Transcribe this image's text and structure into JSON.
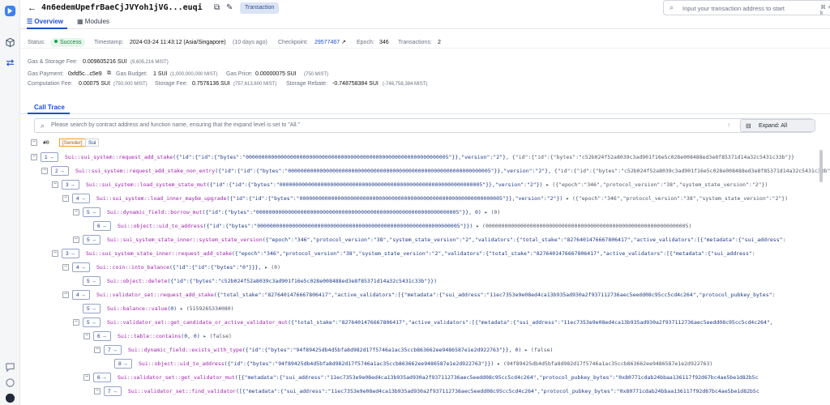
{
  "header": {
    "back_icon": "arrow-left-icon",
    "tx_id": "4n6edemUpefrBaeCjJVYoh1jVG...euqi",
    "badge": "Transaction",
    "search_placeholder": "Input your transaction address to start",
    "shortcut": "⌘ + k"
  },
  "tabs": [
    {
      "label": "Overview",
      "active": true
    },
    {
      "label": "Modules",
      "active": false
    }
  ],
  "status": {
    "status_label": "Status:",
    "status_value": "Success",
    "timestamp_label": "Timestamp:",
    "timestamp_value": "2024-03-24 11:43:12 (Asia/Singapore)",
    "timestamp_ago": "(10 days ago)",
    "checkpoint_label": "Checkpoint:",
    "checkpoint_value": "29577467",
    "epoch_label": "Epoch:",
    "epoch_value": "346",
    "transactions_label": "Transactions:",
    "transactions_value": "2"
  },
  "gas": {
    "fee_label": "Gas & Storage Fee:",
    "fee_value": "0.009605216 SUI",
    "fee_sub": "(9,605,216 MIST)",
    "payment_label": "Gas Payment:",
    "payment_value": "0xfd5c...c5e9",
    "budget_label": "Gas Budget:",
    "budget_value": "1 SUI",
    "budget_sub": "(1,000,000,000 MIST)",
    "price_label": "Gas Price:",
    "price_value": "0.00000075 SUI",
    "price_sub": "(750 MIST)",
    "comp_label": "Computation Fee:",
    "comp_value": "0.00075 SUI",
    "comp_sub": "(750,000 MIST)",
    "storage_label": "Storage Fee:",
    "storage_value": "0.7576136 SUI",
    "storage_sub": "(757,613,600 MIST)",
    "rebate_label": "Storage Rebate:",
    "rebate_value": "-0.748758384 SUI",
    "rebate_sub": "(-748,758,384 MIST)"
  },
  "call_trace": {
    "title": "Call Trace",
    "search_placeholder": "Please search by contract address and function name, ensuring that the expand level is set to \"All.\"",
    "expand_label": "Expand: All",
    "root": {
      "id": "#0",
      "sender": "[Sender]",
      "pkg": "Sui"
    },
    "rows": [
      {
        "depth": "1",
        "fn": "Sui::sui_system::request_add_stake",
        "args": "({\"id\":{\"id\":{\"bytes\":\"0000000000000000000000000000000000000000000000000000000000000005\"}},\"version\":\"2\"},",
        "res": " {\"id\":{\"id\":{\"bytes\":\"c52b024f52a8039c3ad901f16e5c028e008488ed3e8f85371d14a32c5431c33b\"}}"
      },
      {
        "depth": "2",
        "fn": "Sui::sui_system::request_add_stake_non_entry",
        "args": "({\"id\":{\"id\":{\"bytes\":\"0000000000000000000000000000000000000000000000000000000000000005\"}},\"version\":\"2\"},",
        "res": " {\"id\":{\"id\":{\"bytes\":\"c52b024f52a8039c3ad901f16e5c028e008488ed3e8f85371d14a32c5431c33b\"}}"
      },
      {
        "depth": "3",
        "fn": "Sui::sui_system::load_system_state_mut",
        "args": "({\"id\":{\"id\":{\"bytes\":\"0000000000000000000000000000000000000000000000000000000000000005\"}},\"version\":\"2\"})",
        "res": " ▸ ({\"epoch\":\"346\",\"protocol_version\":\"38\",\"system_state_version\":\"2\"})"
      },
      {
        "depth": "4",
        "fn": "Sui::sui_system::load_inner_maybe_upgrade",
        "args": "({\"id\":{\"id\":{\"bytes\":\"0000000000000000000000000000000000000000000000000000000000000005\"}},\"version\":\"2\"})",
        "res": " ▸ ({\"epoch\":\"346\",\"protocol_version\":\"38\",\"system_state_version\":\"2\"})"
      },
      {
        "depth": "5",
        "fn": "Sui::dynamic_field::borrow_mut",
        "args": "({\"id\":{\"bytes\":\"0000000000000000000000000000000000000000000000000000000000000005\"}}, 0)",
        "res": " ▸ (0)"
      },
      {
        "depth": "6",
        "fn": "Sui::object::uid_to_address",
        "args": "({\"id\":{\"bytes\":\"0000000000000000000000000000000000000000000000000000000000000005\"}})",
        "res": " ▸ (0000000000000000000000000000000000000000000000000000000000000005)"
      },
      {
        "depth": "5",
        "fn": "Sui::sui_system_state_inner::system_state_version",
        "args": "({\"epoch\":\"346\",\"protocol_version\":\"38\",\"system_state_version\":\"2\",\"validators\":{\"total_stake\":\"8276401476667806417\",\"active_validators\":[{\"metadata\":{\"sui_address\":",
        "res": ""
      },
      {
        "depth": "3",
        "fn": "Sui::sui_system_state_inner::request_add_stake",
        "args": "({\"epoch\":\"346\",\"protocol_version\":\"38\",\"system_state_version\":\"2\",\"validators\":{\"total_stake\":\"8276401476667806417\",\"active_validators\":[{\"metadata\":{\"sui_address\":",
        "res": ""
      },
      {
        "depth": "4",
        "fn": "Sui::coin::into_balance",
        "args": "({\"id\":{\"id\":{\"bytes\":\"0\"}}},",
        "res": " ▸ (0)"
      },
      {
        "depth": "5",
        "fn": "Sui::object::delete",
        "args": "({\"id\":{\"bytes\":\"c52b024f52a8039c3ad901f16e5c028e008488ed3e8f85371d14a32c5431c33b\"}})",
        "res": ""
      },
      {
        "depth": "4",
        "fn": "Sui::validator_set::request_add_stake",
        "args": "({\"total_stake\":\"8276401476667806417\",\"active_validators\":[{\"metadata\":{\"sui_address\":\"11ec7353e9e08ed4ca13b935ad930a2f937112736aec5eedd08c95cc5cd4c264\",\"protocol_pubkey_bytes\":",
        "res": ""
      },
      {
        "depth": "5",
        "fn": "Sui::balance::value",
        "args": "(0)",
        "res": " ▸ (5159265334080)"
      },
      {
        "depth": "5",
        "fn": "Sui::validator_set::get_candidate_or_active_validator_mut",
        "args": "({\"total_stake\":\"8276401476667806417\",\"active_validators\":[{\"metadata\":{\"sui_address\":\"11ec7353e9e08ed4ca13b935ad930a2f937112736aec5eedd08c95cc5cd4c264\",",
        "res": ""
      },
      {
        "depth": "6",
        "fn": "Sui::table::contains",
        "args": "(0, 0)",
        "res": " ▸ (false)"
      },
      {
        "depth": "7",
        "fn": "Sui::dynamic_field::exists_with_type",
        "args": "({\"id\":{\"bytes\":\"94f89425db4d5bfa8d982d17f5746a1ac35ccb863662ee9486587e1e2d922763\"}}, 0)",
        "res": " ▸ (false)"
      },
      {
        "depth": "8",
        "fn": "Sui::object::uid_to_address",
        "args": "({\"id\":{\"bytes\":\"94f89425db4d5bfa8d982d17f5746a1ac35ccb863662ee9486587e1e2d922763\"}})",
        "res": " ▸ (94f89425db4d5bfa8d982d17f5746a1ac35ccb863662ee9486587e1e2d922763)"
      },
      {
        "depth": "6",
        "fn": "Sui::validator_set::get_validator_mut",
        "args": "([{\"metadata\":{\"sui_address\":\"11ec7353e9e08ed4ca13b935ad930a2f937112736aec5eedd08c95cc5cd4c264\",\"protocol_pubkey_bytes\":\"0x80771cdab24bbaa136117f92d67bc4ae5be1d82b5c",
        "res": ""
      },
      {
        "depth": "7",
        "fn": "Sui::validator_set::find_validator",
        "args": "([{\"metadata\":{\"sui_address\":\"11ec7353e9e08ed4ca13b935ad930a2f937112736aec5eedd08c95cc5cd4c264\",\"protocol_pubkey_bytes\":\"0x80771cdab24bbaa136117f92d67bc4ae5be1d82b5c",
        "res": ""
      }
    ]
  }
}
